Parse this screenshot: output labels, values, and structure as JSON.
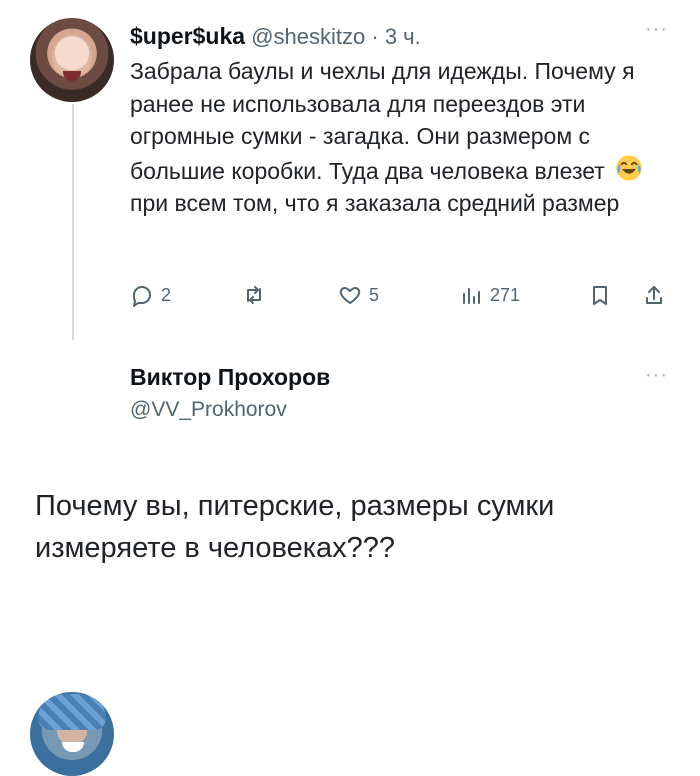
{
  "tweets": [
    {
      "author": {
        "display_name": "$uper$uka",
        "username": "@sheskitzo",
        "separator": "·",
        "time": "3 ч."
      },
      "text": {
        "before_emoji": "Забрала баулы и чехлы для идежды. Почему я ранее не использовала для переездов эти огромные сумки - загадка. Они размером с большие коробки. Туда два человека влезет",
        "emoji": "laughing-face-emoji",
        "after_emoji": "при всем том, что я заказала средний размер"
      },
      "actions": {
        "reply_count": "2",
        "retweet_count": "",
        "like_count": "5",
        "views_count": "271"
      },
      "more": "···"
    },
    {
      "author": {
        "display_name": "Виктор Прохоров",
        "username": "@VV_Prokhorov"
      },
      "text": "Почему вы, питерские, размеры сумки измеряете в человеках???",
      "more": "···"
    }
  ],
  "colors": {
    "text": "#202327",
    "secondary": "#536471",
    "thread_line": "#cfd9de"
  },
  "icons": {
    "reply": "reply-icon",
    "retweet": "retweet-icon",
    "like": "heart-icon",
    "views": "views-icon",
    "bookmark": "bookmark-icon",
    "share": "share-icon"
  }
}
